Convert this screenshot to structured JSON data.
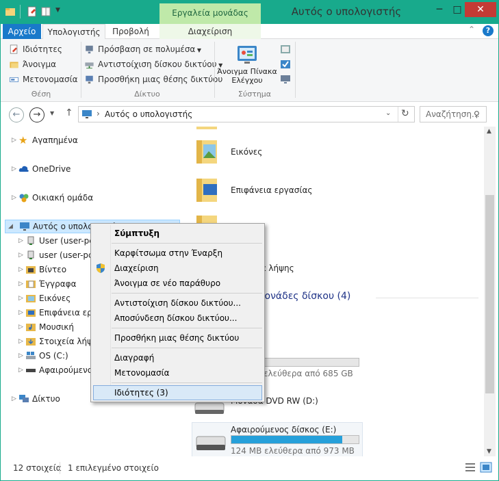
{
  "window": {
    "title": "Αυτός ο υπολογιστής",
    "context_tools": "Εργαλεία μονάδας δίσκου",
    "min": "─",
    "max": "□",
    "close": "✕"
  },
  "tabs": {
    "file": "Αρχείο",
    "computer": "Υπολογιστής",
    "view": "Προβολή",
    "manage": "Διαχείριση"
  },
  "ribbon": {
    "location": {
      "group": "Θέση",
      "items": [
        "Ιδιότητες",
        "Άνοιγμα",
        "Μετονομασία"
      ]
    },
    "network": {
      "group": "Δίκτυο",
      "items": [
        "Πρόσβαση σε πολυμέσα",
        "Αντιστοίχιση δίσκου δικτύου",
        "Προσθήκη μιας θέσης δικτύου"
      ]
    },
    "system": {
      "group": "Σύστημα",
      "control_panel_line1": "Άνοιγμα Πίνακα",
      "control_panel_line2": "Ελέγχου"
    }
  },
  "address": {
    "path": "Αυτός ο υπολογιστής",
    "separator": "›",
    "search_placeholder": "Αναζήτηση..."
  },
  "nav": {
    "favorites": "Αγαπημένα",
    "onedrive": "OneDrive",
    "homegroup": "Οικιακή ομάδα",
    "thispc": "Αυτός ο υπολογιστής",
    "network": "Δίκτυο",
    "children": [
      "User (user-pc)",
      "user (user-pc)",
      "Βίντεο",
      "Έγγραφα",
      "Εικόνες",
      "Επιφάνεια εργασίας",
      "Μουσική",
      "Στοιχεία λήψης",
      "OS (C:)",
      "Αφαιρούμενος δίσκος (E:)"
    ]
  },
  "content": {
    "folders": [
      "Εικόνες",
      "Επιφάνεια εργασίας",
      "Στοιχεία λήψης"
    ],
    "devices_header": "Συσκευές και μονάδες δίσκου (4)",
    "c_drive_free": "441 GB ελεύθερα από 685 GB",
    "dvd": "Μονάδα DVD RW (D:)",
    "removable_name": "Αφαιρούμενος δίσκος (E:)",
    "removable_free": "124 MB ελεύθερα από 973 MB",
    "removable_used_fraction": 0.87
  },
  "context_menu": {
    "collapse": "Σύμπτυξη",
    "pin": "Καρφίτσωμα στην Έναρξη",
    "manage": "Διαχείριση",
    "open_new": "Άνοιγμα σε νέο παράθυρο",
    "map": "Αντιστοίχιση δίσκου δικτύου...",
    "disconnect": "Αποσύνδεση δίσκου δικτύου...",
    "add_location": "Προσθήκη μιας θέσης δικτύου",
    "delete": "Διαγραφή",
    "rename": "Μετονομασία",
    "properties": "Ιδιότητες (3)"
  },
  "status": {
    "count": "12 στοιχεία",
    "selected": "1 επιλεγμένο στοιχείο"
  },
  "colors": {
    "accent": "#18aa8c",
    "file_tab": "#1979ca",
    "selection": "#cce8ff",
    "drive_bar": "#26a0da"
  }
}
